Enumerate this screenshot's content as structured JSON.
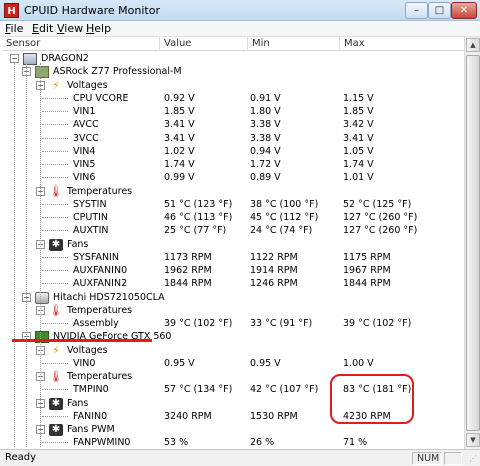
{
  "window": {
    "title": "CPUID Hardware Monitor",
    "app_icon_letter": "H",
    "controls": {
      "minimize": "–",
      "maximize": "□",
      "close": "✕"
    }
  },
  "menu": [
    {
      "label": "File",
      "access_key": "F",
      "rest": "ile"
    },
    {
      "label": "Edit",
      "access_key": "E",
      "rest": "dit"
    },
    {
      "label": "View",
      "access_key": "V",
      "rest": "iew"
    },
    {
      "label": "Help",
      "access_key": "H",
      "rest": "elp"
    }
  ],
  "columns": {
    "sensor": "Sensor",
    "value": "Value",
    "min": "Min",
    "max": "Max"
  },
  "tree": [
    {
      "kind": "device",
      "icon": "computer-icon",
      "label": "DRAGON2",
      "level": 0,
      "expander": "−"
    },
    {
      "kind": "device",
      "icon": "motherboard-icon",
      "label": "ASRock Z77 Professional-M",
      "level": 1,
      "expander": "−"
    },
    {
      "kind": "group",
      "icon": "voltage-icon",
      "label": "Voltages",
      "level": 2,
      "expander": "−"
    },
    {
      "kind": "sensor",
      "label": "CPU VCORE",
      "value": "0.92 V",
      "min": "0.91 V",
      "max": "1.15 V"
    },
    {
      "kind": "sensor",
      "label": "VIN1",
      "value": "1.85 V",
      "min": "1.80 V",
      "max": "1.85 V"
    },
    {
      "kind": "sensor",
      "label": "AVCC",
      "value": "3.41 V",
      "min": "3.38 V",
      "max": "3.42 V"
    },
    {
      "kind": "sensor",
      "label": "3VCC",
      "value": "3.41 V",
      "min": "3.38 V",
      "max": "3.41 V"
    },
    {
      "kind": "sensor",
      "label": "VIN4",
      "value": "1.02 V",
      "min": "0.94 V",
      "max": "1.05 V"
    },
    {
      "kind": "sensor",
      "label": "VIN5",
      "value": "1.74 V",
      "min": "1.72 V",
      "max": "1.74 V"
    },
    {
      "kind": "sensor",
      "label": "VIN6",
      "value": "0.99 V",
      "min": "0.89 V",
      "max": "1.01 V"
    },
    {
      "kind": "group",
      "icon": "thermometer-icon",
      "label": "Temperatures",
      "level": 2,
      "expander": "−"
    },
    {
      "kind": "sensor",
      "label": "SYSTIN",
      "value": "51 °C  (123 °F)",
      "min": "38 °C  (100 °F)",
      "max": "52 °C  (125 °F)"
    },
    {
      "kind": "sensor",
      "label": "CPUTIN",
      "value": "46 °C  (113 °F)",
      "min": "45 °C  (112 °F)",
      "max": "127 °C  (260 °F)"
    },
    {
      "kind": "sensor",
      "label": "AUXTIN",
      "value": "25 °C  (77 °F)",
      "min": "24 °C  (74 °F)",
      "max": "127 °C  (260 °F)"
    },
    {
      "kind": "group",
      "icon": "fan-icon",
      "label": "Fans",
      "level": 2,
      "expander": "−"
    },
    {
      "kind": "sensor",
      "label": "SYSFANIN",
      "value": "1173 RPM",
      "min": "1122 RPM",
      "max": "1175 RPM"
    },
    {
      "kind": "sensor",
      "label": "AUXFANIN0",
      "value": "1962 RPM",
      "min": "1914 RPM",
      "max": "1967 RPM"
    },
    {
      "kind": "sensor",
      "label": "AUXFANIN2",
      "value": "1844 RPM",
      "min": "1246 RPM",
      "max": "1844 RPM"
    },
    {
      "kind": "device",
      "icon": "hard-drive-icon",
      "label": "Hitachi HDS721050CLA",
      "level": 1,
      "expander": "−"
    },
    {
      "kind": "group",
      "icon": "thermometer-icon",
      "label": "Temperatures",
      "level": 2,
      "expander": "−"
    },
    {
      "kind": "sensor",
      "label": "Assembly",
      "value": "39 °C  (102 °F)",
      "min": "33 °C  (91 °F)",
      "max": "39 °C  (102 °F)"
    },
    {
      "kind": "device",
      "icon": "graphics-card-icon",
      "label": "NVIDIA GeForce GTX 560",
      "level": 1,
      "expander": "−"
    },
    {
      "kind": "group",
      "icon": "voltage-icon",
      "label": "Voltages",
      "level": 2,
      "expander": "−"
    },
    {
      "kind": "sensor",
      "label": "VIN0",
      "value": "0.95 V",
      "min": "0.95 V",
      "max": "1.00 V"
    },
    {
      "kind": "group",
      "icon": "thermometer-icon",
      "label": "Temperatures",
      "level": 2,
      "expander": "−"
    },
    {
      "kind": "sensor",
      "label": "TMPIN0",
      "value": "57 °C  (134 °F)",
      "min": "42 °C  (107 °F)",
      "max": "83 °C  (181 °F)"
    },
    {
      "kind": "group",
      "icon": "fan-icon",
      "label": "Fans",
      "level": 2,
      "expander": "−"
    },
    {
      "kind": "sensor",
      "label": "FANIN0",
      "value": "3240 RPM",
      "min": "1530 RPM",
      "max": "4230 RPM"
    },
    {
      "kind": "group",
      "icon": "fan-icon",
      "label": "Fans PWM",
      "level": 2,
      "expander": "−"
    },
    {
      "kind": "sensor",
      "label": "FANPWMIN0",
      "value": "53 %",
      "min": "26 %",
      "max": "71 %"
    }
  ],
  "status": {
    "text": "Ready",
    "num": "NUM"
  },
  "colors": {
    "annotation": "#e41b1b"
  }
}
